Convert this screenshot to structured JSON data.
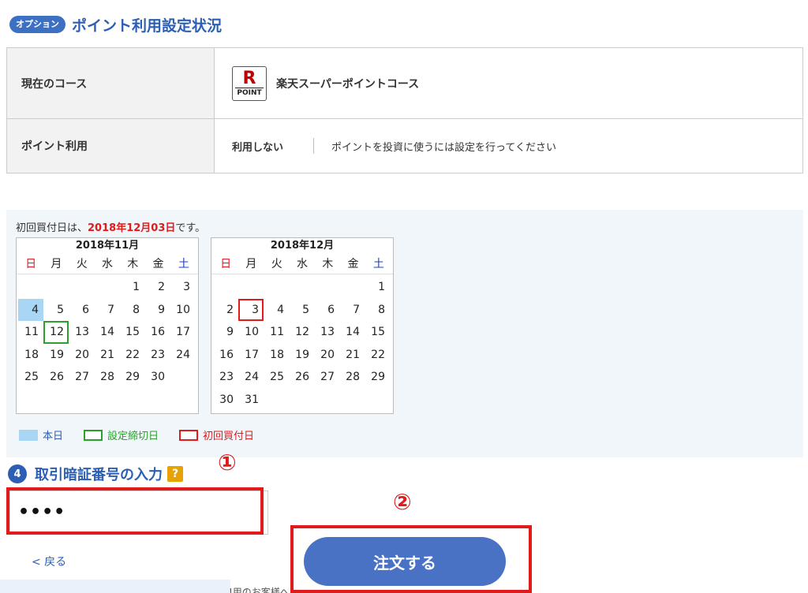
{
  "header": {
    "badge": "オプション",
    "title": "ポイント利用設定状況"
  },
  "settings": {
    "course_label": "現在のコース",
    "course_logo_r": "R",
    "course_logo_text": "POINT",
    "course_value": "楽天スーパーポイントコース",
    "point_use_label": "ポイント利用",
    "point_use_value": "利用しない",
    "point_use_note": "ポイントを投資に使うには設定を行ってください"
  },
  "first_buy": {
    "prefix": "初回買付日は、",
    "date": "2018年12月03日",
    "suffix": "です。"
  },
  "calendar": {
    "weekdays": [
      "日",
      "月",
      "火",
      "水",
      "木",
      "金",
      "土"
    ],
    "months": [
      {
        "title": "2018年11月",
        "days": [
          "",
          "",
          "",
          "",
          "1",
          "2",
          "3",
          "4",
          "5",
          "6",
          "7",
          "8",
          "9",
          "10",
          "11",
          "12",
          "13",
          "14",
          "15",
          "16",
          "17",
          "18",
          "19",
          "20",
          "21",
          "22",
          "23",
          "24",
          "25",
          "26",
          "27",
          "28",
          "29",
          "30"
        ],
        "today": "4",
        "deadline": "12"
      },
      {
        "title": "2018年12月",
        "days": [
          "",
          "",
          "",
          "",
          "",
          "",
          "1",
          "2",
          "3",
          "4",
          "5",
          "6",
          "7",
          "8",
          "9",
          "10",
          "11",
          "12",
          "13",
          "14",
          "15",
          "16",
          "17",
          "18",
          "19",
          "20",
          "21",
          "22",
          "23",
          "24",
          "25",
          "26",
          "27",
          "28",
          "29",
          "30",
          "31"
        ],
        "first_buy": "3"
      }
    ],
    "legend": {
      "today": "本日",
      "deadline": "設定締切日",
      "first_buy": "初回買付日"
    }
  },
  "step4": {
    "number": "4",
    "title": "取引暗証番号の入力",
    "help": "?",
    "password_value": "••••"
  },
  "annotations": {
    "one": "①",
    "two": "②"
  },
  "actions": {
    "back": "< 戻る",
    "order": "注文する"
  },
  "footer": {
    "partial_text": "!用のお客様へ"
  },
  "colors": {
    "accent": "#2c5fb3",
    "button": "#4a72c4",
    "highlight": "#e01b1b",
    "deadline": "#2ca02c",
    "today": "#a9d6f5"
  }
}
